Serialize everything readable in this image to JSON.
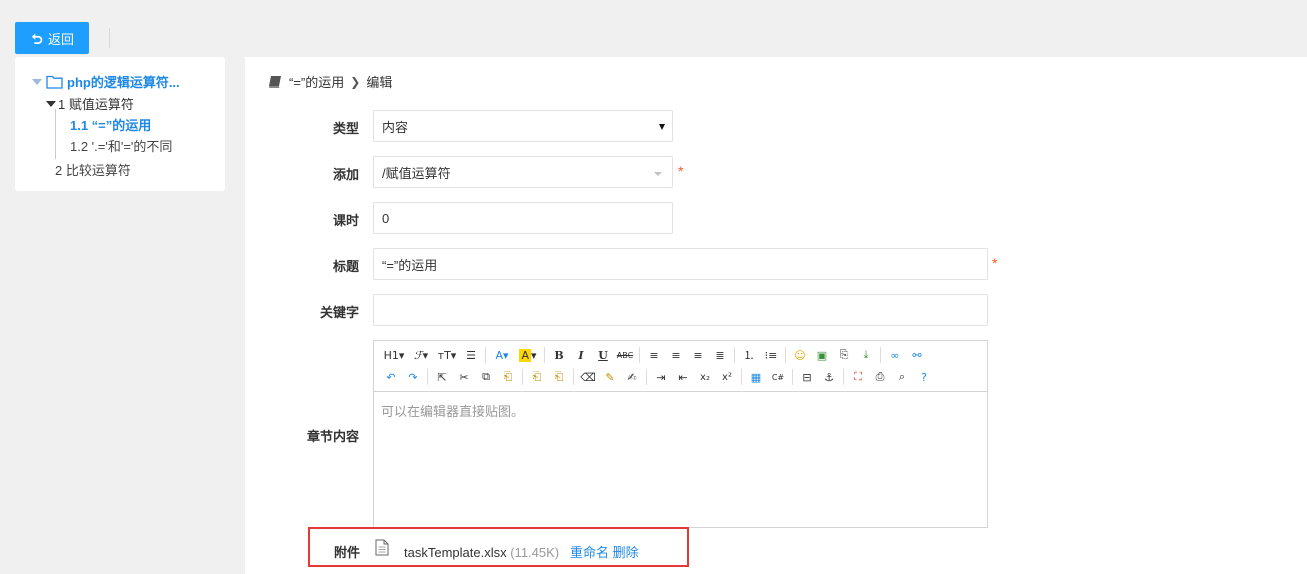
{
  "toolbar": {
    "back_label": "返回"
  },
  "tree": {
    "root": "php的逻辑运算符...",
    "items": [
      {
        "label": "1 赋值运算符"
      },
      {
        "label": "1.1 “=”的运用"
      },
      {
        "label": "1.2 '.='和'='的不同"
      },
      {
        "label": "2 比较运算符"
      }
    ]
  },
  "breadcrumb": {
    "current": "“=”的运用",
    "action": "编辑"
  },
  "form": {
    "type_label": "类型",
    "type_value": "内容",
    "add_label": "添加",
    "add_value": "/赋值运算符",
    "hours_label": "课时",
    "hours_value": "0",
    "title_label": "标题",
    "title_value": "“=”的运用",
    "keyword_label": "关键字",
    "keyword_value": "",
    "content_label": "章节内容",
    "editor_placeholder": "可以在编辑器直接贴图。",
    "required_mark": "*"
  },
  "attachment": {
    "label": "附件",
    "filename": "taskTemplate.xlsx",
    "size": "(11.45K)",
    "rename": "重命名",
    "delete": "删除"
  },
  "colors": {
    "accent": "#1e9fff",
    "link": "#1e88e5",
    "highlight_border": "#e53935"
  }
}
